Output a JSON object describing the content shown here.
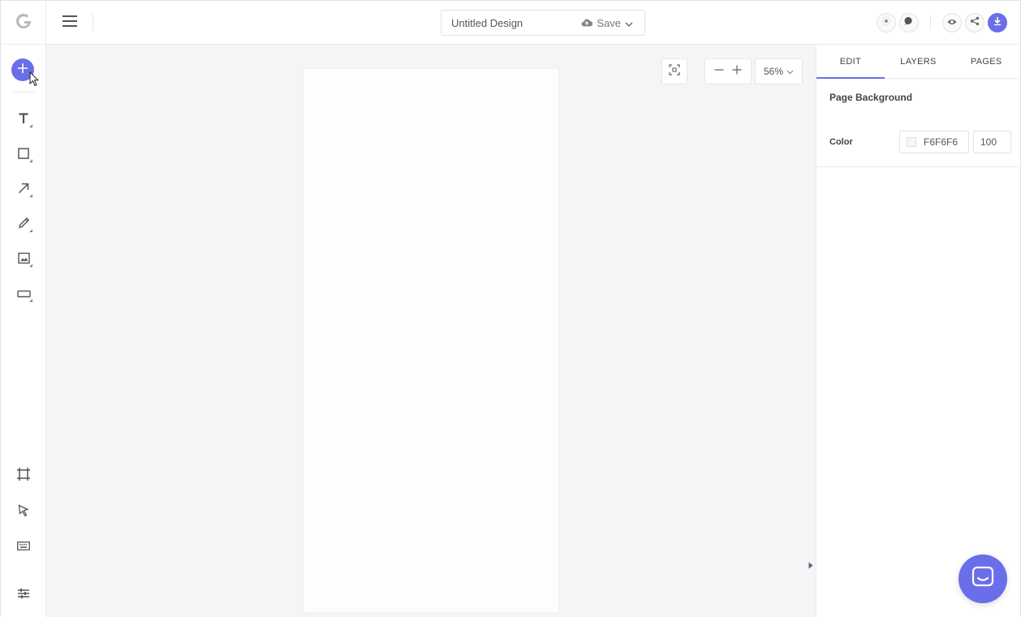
{
  "header": {
    "document_title": "Untitled Design",
    "save_label": "Save",
    "icons": [
      "g-logo-icon",
      "hamburger-menu-icon",
      "cloud-icon",
      "chevron-down-icon",
      "sun-icon",
      "comment-icon",
      "eye-icon",
      "share-icon",
      "download-icon"
    ]
  },
  "left_toolbar": {
    "tools": [
      "add",
      "text",
      "rectangle",
      "arrow",
      "pencil",
      "image",
      "button",
      "frame",
      "select",
      "keyboard",
      "adjustments"
    ]
  },
  "canvas": {
    "zoom_label": "56%"
  },
  "right_panel": {
    "tabs": [
      {
        "label": "EDIT",
        "active": true
      },
      {
        "label": "LAYERS",
        "active": false
      },
      {
        "label": "PAGES",
        "active": false
      }
    ],
    "section_title": "Page Background",
    "color_label": "Color",
    "color_value": "F6F6F6",
    "opacity_value": "100"
  },
  "colors": {
    "accent": "#6a6ee8",
    "canvas_bg": "#f5f4f6",
    "page_bg": "#fdfdfc",
    "swatch": "#f6f6f6"
  }
}
